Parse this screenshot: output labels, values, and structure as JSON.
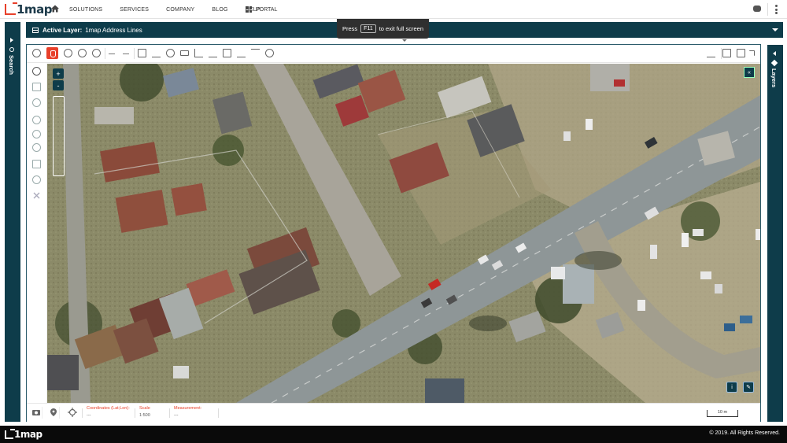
{
  "brand": {
    "logo": "1map"
  },
  "nav": {
    "home_icon": "home-icon",
    "links": [
      "SOLUTIONS",
      "SERVICES",
      "COMPANY",
      "BLOG",
      "HELP"
    ],
    "portal": "PORTAL"
  },
  "fullscreen_hint": {
    "prefix": "Press",
    "key": "F11",
    "suffix": "to exit full screen"
  },
  "left_panel": {
    "label": "Search"
  },
  "right_panel": {
    "label": "Layers"
  },
  "active_layer": {
    "label": "Active Layer:",
    "value": "1map Address Lines"
  },
  "toolbar": {
    "tools": [
      "help-icon",
      "pan-hand-icon",
      "globe-icon",
      "zoom-in-icon",
      "zoom-out-icon",
      "back-arrow-icon",
      "forward-arrow-icon",
      "grid-icon",
      "elevation-icon",
      "circle-icon",
      "rectangle-icon",
      "line-icon",
      "corner-icon",
      "print-icon",
      "download-icon",
      "upload-icon",
      "target-icon"
    ],
    "right_tools": [
      "download-icon",
      "binoculars-icon",
      "layout-icon",
      "expand-icon"
    ]
  },
  "zoom": {
    "plus": "+",
    "minus": "-"
  },
  "map_controls": {
    "collapse": "«",
    "info": "i",
    "edit": "✎"
  },
  "status": {
    "coordinates_label": "Coordinates (Lat;Lon):",
    "coordinates_value": "---",
    "scale_label": "Scale",
    "scale_value": "1:500",
    "measurement_label": "Measurement:",
    "measurement_value": "---",
    "scalebar": "10 m"
  },
  "footer": {
    "logo": "1map",
    "copyright": "© 2019. All Rights Reserved."
  },
  "colors": {
    "accent": "#e8402a",
    "panel": "#0e3c4a",
    "footer": "#0a0a0a"
  }
}
